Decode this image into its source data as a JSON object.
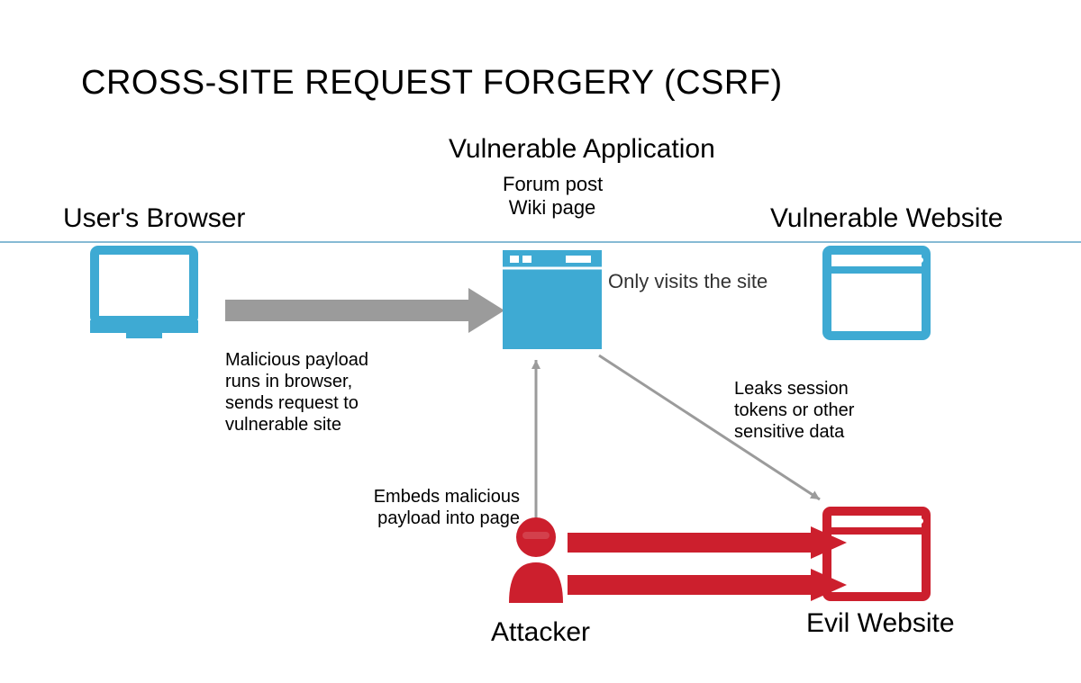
{
  "title": "CROSS-SITE REQUEST FORGERY (CSRF)",
  "nodes": {
    "vapp": {
      "title": "Vulnerable Application",
      "sub1": "Forum post",
      "sub2": "Wiki page",
      "note": "Only visits the site"
    },
    "browser": {
      "title": "User's Browser"
    },
    "site": {
      "title": "Vulnerable Website"
    },
    "attacker": {
      "title": "Attacker"
    },
    "evilsite": {
      "title": "Evil Website"
    }
  },
  "edges": {
    "b_to_site": "Malicious payload\nruns in browser,\nsends request to\nvulnerable site",
    "a_to_vapp": "Embeds malicious\npayload into page",
    "site_to_evil": "Leaks session\ntokens or other\nsensitive data"
  },
  "colors": {
    "blue": "#3eaad3",
    "blue_stroke": "#0e76a8",
    "red": "#cc1f2d",
    "grey": "#9b9b9b",
    "text": "#000000"
  }
}
